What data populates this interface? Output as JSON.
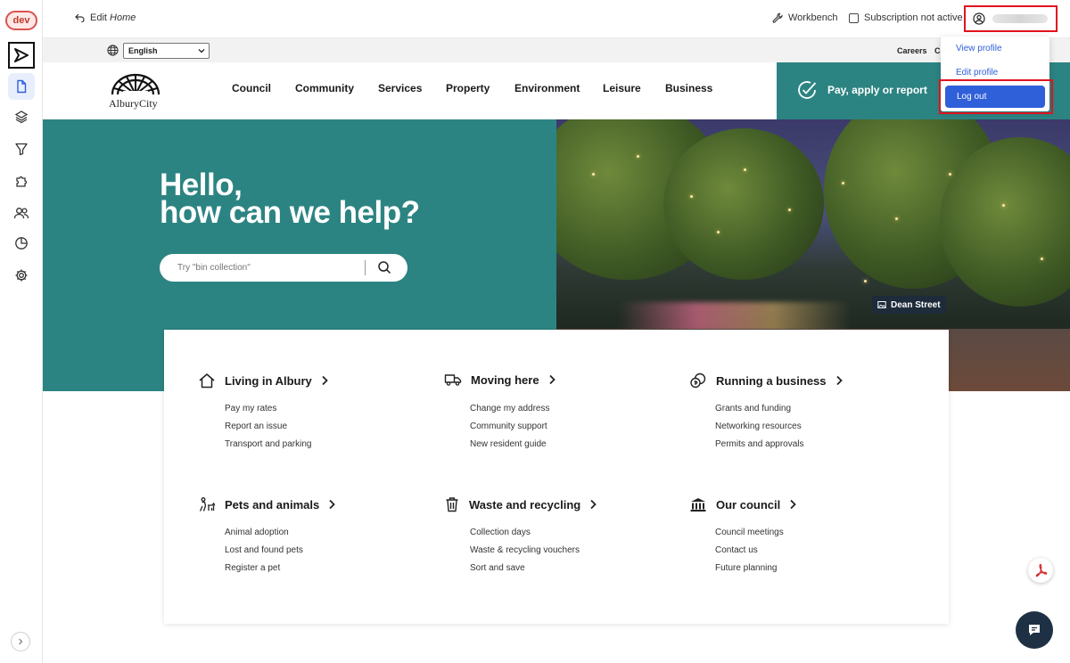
{
  "cms": {
    "env_badge": "dev",
    "edit_prefix": "Edit",
    "edit_page": "Home",
    "workbench_label": "Workbench",
    "subscription_label": "Subscription not active",
    "user_menu": {
      "view_profile": "View profile",
      "edit_profile": "Edit profile",
      "log_out": "Log out"
    },
    "rail_icons": [
      "play-logo-icon",
      "document-icon",
      "layers-icon",
      "funnel-icon",
      "puzzle-icon",
      "users-icon",
      "pie-chart-icon",
      "gear-icon"
    ]
  },
  "site": {
    "language": "English",
    "utility_links": {
      "careers": "Careers",
      "contact_truncated": "C"
    },
    "logo_text": "AlburyCity",
    "nav": [
      "Council",
      "Community",
      "Services",
      "Property",
      "Environment",
      "Leisure",
      "Business"
    ],
    "pay_cta": "Pay, apply or report",
    "hero": {
      "title_line1": "Hello,",
      "title_line2": "how can we help?",
      "search_placeholder": "Try \"bin collection\"",
      "photo_caption": "Dean Street"
    },
    "groups": [
      {
        "title": "Living in Albury",
        "icon": "house-icon",
        "links": [
          "Pay my rates",
          "Report an issue",
          "Transport and parking"
        ]
      },
      {
        "title": "Moving here",
        "icon": "truck-icon",
        "links": [
          "Change my address",
          "Community support",
          "New resident guide"
        ]
      },
      {
        "title": "Running a business",
        "icon": "coins-icon",
        "links": [
          "Grants and funding",
          "Networking resources",
          "Permits and approvals"
        ]
      },
      {
        "title": "Pets and animals",
        "icon": "pet-icon",
        "links": [
          "Animal adoption",
          "Lost and found pets",
          "Register a pet"
        ]
      },
      {
        "title": "Waste and recycling",
        "icon": "bin-icon",
        "links": [
          "Collection days",
          "Waste & recycling vouchers",
          "Sort and save"
        ]
      },
      {
        "title": "Our council",
        "icon": "council-building-icon",
        "links": [
          "Council meetings",
          "Contact us",
          "Future planning"
        ]
      }
    ]
  },
  "colors": {
    "teal": "#2c8482",
    "accent_blue": "#2f5fd9",
    "highlight_red": "#e0141e",
    "chat_navy": "#1e3144"
  }
}
